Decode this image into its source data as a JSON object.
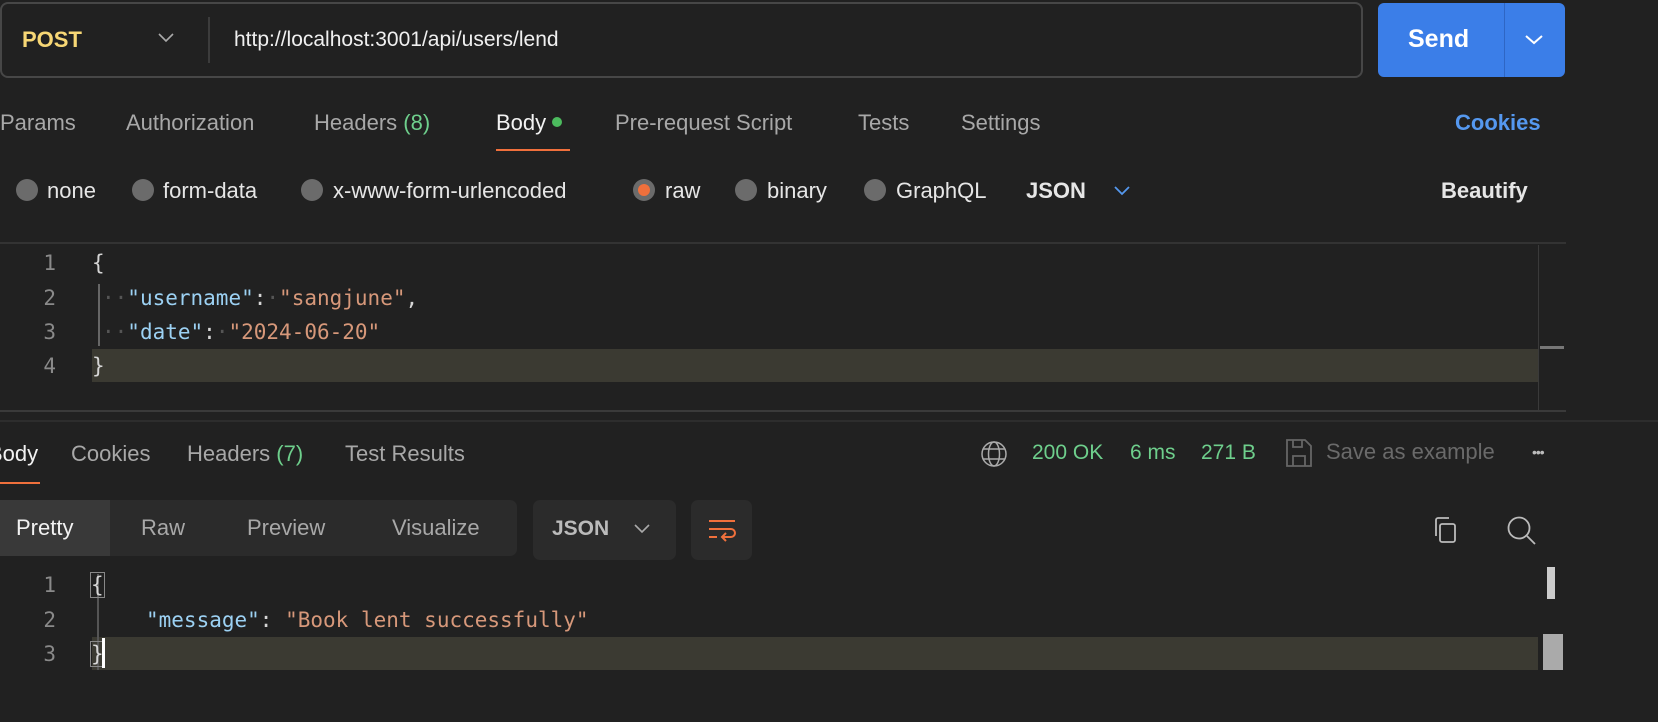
{
  "request": {
    "method": "POST",
    "url": "http://localhost:3001/api/users/lend",
    "send_label": "Send"
  },
  "req_tabs": [
    {
      "label": "Params"
    },
    {
      "label": "Authorization"
    },
    {
      "label": "Headers",
      "count": "(8)"
    },
    {
      "label": "Body",
      "active": true
    },
    {
      "label": "Pre-request Script"
    },
    {
      "label": "Tests"
    },
    {
      "label": "Settings"
    }
  ],
  "cookies_link": "Cookies",
  "body_types": [
    {
      "label": "none"
    },
    {
      "label": "form-data"
    },
    {
      "label": "x-www-form-urlencoded"
    },
    {
      "label": "raw",
      "selected": true
    },
    {
      "label": "binary"
    },
    {
      "label": "GraphQL"
    }
  ],
  "body_format": "JSON",
  "beautify": "Beautify",
  "request_body": {
    "line_numbers": [
      "1",
      "2",
      "3",
      "4"
    ],
    "open": "{",
    "k1": "\"username\"",
    "v1": "\"sangjune\"",
    "k2": "\"date\"",
    "v2": "\"2024-06-20\"",
    "colon": ":",
    "comma": ",",
    "close": "}"
  },
  "resp_tabs": [
    {
      "label": "Body",
      "active": true
    },
    {
      "label": "Cookies"
    },
    {
      "label": "Headers",
      "count": "(7)"
    },
    {
      "label": "Test Results"
    }
  ],
  "status": {
    "code": "200 OK",
    "time": "6 ms",
    "size": "271 B",
    "save": "Save as example",
    "more": "•••"
  },
  "view_modes": [
    {
      "label": "Pretty",
      "active": true
    },
    {
      "label": "Raw"
    },
    {
      "label": "Preview"
    },
    {
      "label": "Visualize"
    }
  ],
  "resp_format": "JSON",
  "response_body": {
    "line_numbers": [
      "1",
      "2",
      "3"
    ],
    "open": "{",
    "key": "\"message\"",
    "value": "\"Book lent successfully\"",
    "colon": ":",
    "close": "}"
  },
  "colors": {
    "accent": "#3b7ee8",
    "tab_underline": "#f0703c",
    "method": "#f7d775",
    "status": "#6ecf8c"
  }
}
